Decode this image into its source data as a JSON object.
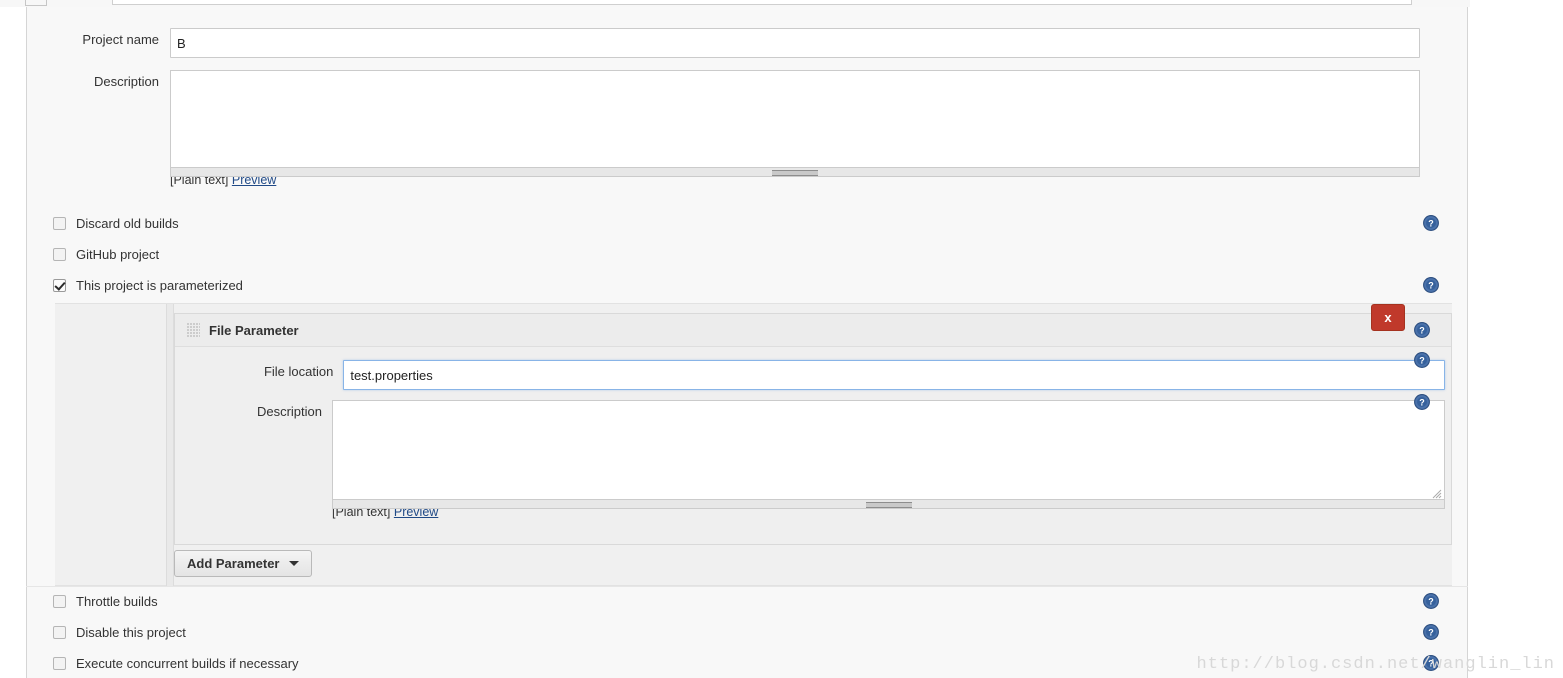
{
  "form": {
    "project_name": {
      "label": "Project name",
      "value": "B"
    },
    "description": {
      "label": "Description",
      "value": "",
      "plain_text_label": "[Plain text]",
      "preview_link": "Preview"
    }
  },
  "checkboxes": [
    {
      "label": "Discard old builds",
      "checked": false,
      "help": "help-icon"
    },
    {
      "label": "GitHub project",
      "checked": false,
      "help": "help-icon"
    },
    {
      "label": "This project is parameterized",
      "checked": true,
      "help": "help-icon"
    },
    {
      "label": "Throttle builds",
      "checked": false,
      "help": "help-icon"
    },
    {
      "label": "Disable this project",
      "checked": false,
      "help": "help-icon"
    },
    {
      "label": "Execute concurrent builds if necessary",
      "checked": false,
      "help": "help-icon"
    }
  ],
  "parameter": {
    "title": "File Parameter",
    "drag_handle": "drag-handle-icon",
    "delete_label": "x",
    "file_location": {
      "label": "File location",
      "value": "test.properties",
      "focused": true
    },
    "description": {
      "label": "Description",
      "value": "",
      "plain_text_label": "[Plain text]",
      "preview_link": "Preview"
    }
  },
  "add_parameter_button": {
    "label": "Add Parameter",
    "caret": "chevron-down-icon"
  },
  "watermark": "http://blog.csdn.net/wanglin_lin",
  "colors": {
    "delete_button": "#c0392b",
    "help_icon": "#36619c",
    "link": "#204a87",
    "focus_border": "#88b4e7",
    "panel_bg": "#f8f8f8",
    "param_bg": "#efefef"
  }
}
